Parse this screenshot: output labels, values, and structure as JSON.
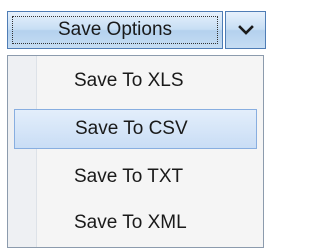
{
  "split_button": {
    "label": "Save Options",
    "dropdown_icon": "chevron-down-icon"
  },
  "menu": {
    "items": [
      {
        "label": "Save To XLS",
        "state": "normal"
      },
      {
        "label": "Save To CSV",
        "state": "hover"
      },
      {
        "label": "Save To TXT",
        "state": "normal"
      },
      {
        "label": "Save To XML",
        "state": "normal"
      }
    ]
  },
  "colors": {
    "button_border": "#4f7db5",
    "menu_border": "#8c9bad",
    "hover_border": "#88aee0",
    "hover_fill": "#c9ddf5"
  }
}
